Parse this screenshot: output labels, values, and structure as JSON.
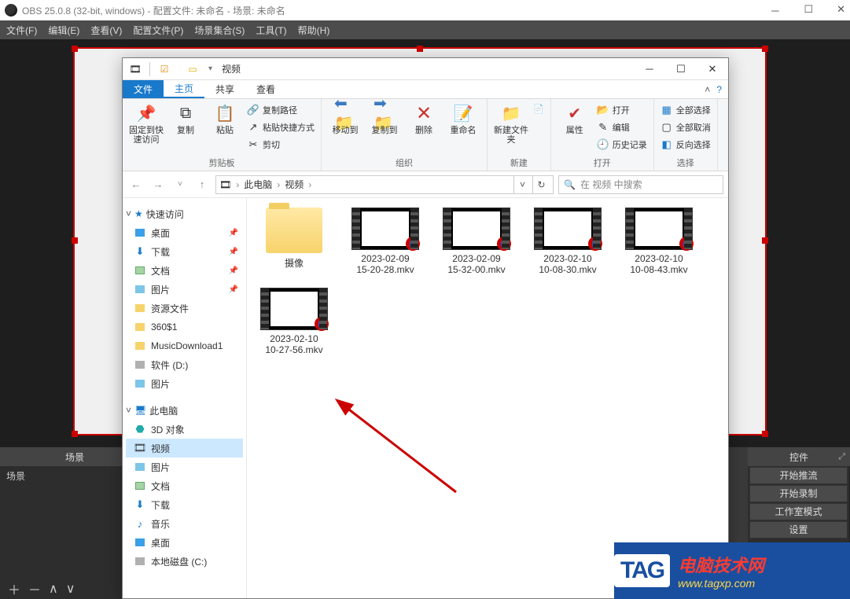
{
  "obs": {
    "title": "OBS 25.0.8 (32-bit, windows) - 配置文件: 未命名 - 场景: 未命名",
    "menu": [
      "文件(F)",
      "编辑(E)",
      "查看(V)",
      "配置文件(P)",
      "场景集合(S)",
      "工具(T)",
      "帮助(H)"
    ],
    "panels": {
      "scenes": "场景",
      "controls": "控件",
      "scene_item": "场景"
    },
    "controls": [
      "开始推流",
      "开始录制",
      "工作室模式",
      "设置"
    ],
    "toolbar": [
      "＋",
      "－",
      "∧",
      "∨"
    ]
  },
  "explorer": {
    "title": "视频",
    "tabs": {
      "file": "文件",
      "home": "主页",
      "share": "共享",
      "view": "查看"
    },
    "ribbon": {
      "pin": "固定到快速访问",
      "copy": "复制",
      "paste": "粘贴",
      "copy_path": "复制路径",
      "paste_shortcut": "粘贴快捷方式",
      "cut": "剪切",
      "clipboard_grp": "剪贴板",
      "move_to": "移动到",
      "copy_to": "复制到",
      "delete": "删除",
      "rename": "重命名",
      "organize_grp": "组织",
      "new_folder": "新建文件夹",
      "new_grp": "新建",
      "properties": "属性",
      "open": "打开",
      "edit": "编辑",
      "history": "历史记录",
      "open_grp": "打开",
      "select_all": "全部选择",
      "select_none": "全部取消",
      "invert": "反向选择",
      "select_grp": "选择"
    },
    "breadcrumb": {
      "root": "此电脑",
      "current": "视频"
    },
    "search_placeholder": "在 视频 中搜索",
    "nav": {
      "quick": "快速访问",
      "items1": [
        "桌面",
        "下载",
        "文档",
        "图片",
        "资源文件",
        "360$1",
        "MusicDownload1",
        "软件 (D:)",
        "图片"
      ],
      "thispc": "此电脑",
      "items2": [
        "3D 对象",
        "视频",
        "图片",
        "文档",
        "下载",
        "音乐",
        "桌面",
        "本地磁盘 (C:)"
      ]
    },
    "files": {
      "folder": "摄像",
      "videos": [
        {
          "l1": "2023-02-09",
          "l2": "15-20-28.mkv"
        },
        {
          "l1": "2023-02-09",
          "l2": "15-32-00.mkv"
        },
        {
          "l1": "2023-02-10",
          "l2": "10-08-30.mkv"
        },
        {
          "l1": "2023-02-10",
          "l2": "10-08-43.mkv"
        },
        {
          "l1": "2023-02-10",
          "l2": "10-27-56.mkv"
        }
      ]
    }
  },
  "watermark": {
    "tag": "TAG",
    "cn": "电脑技术网",
    "url": "www.tagxp.com"
  }
}
